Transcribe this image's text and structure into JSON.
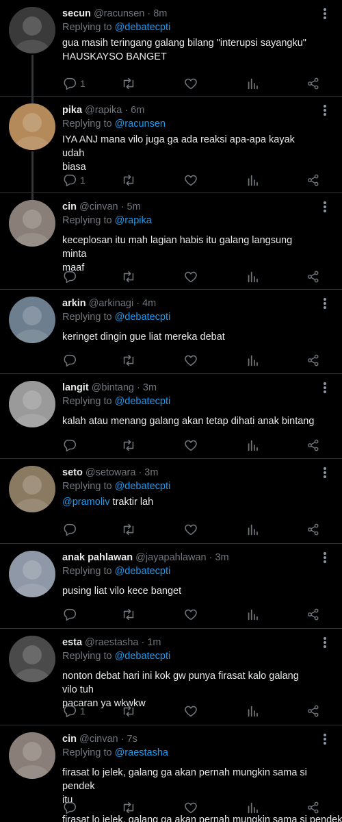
{
  "tweets": [
    {
      "name": "secun",
      "handle": "@racunsen",
      "time": "· 8m",
      "reply_prefix": "Replying to",
      "reply_to": "@debatecpti",
      "text_lines": [
        "gua masih teringang galang bilang \"interupsi sayangku\"",
        "HAUSKAYSO BANGET"
      ],
      "mention_lead": "",
      "reply_count": "1",
      "avatar_color": "#3a3a3a"
    },
    {
      "name": "pika",
      "handle": "@rapika",
      "time": "· 6m",
      "reply_prefix": "Replying to",
      "reply_to": "@racunsen",
      "text_lines": [
        "IYA ANJ mana vilo juga ga ada reaksi apa-apa kayak udah",
        "biasa"
      ],
      "mention_lead": "",
      "reply_count": "1",
      "avatar_color": "#b48a5a"
    },
    {
      "name": "cin",
      "handle": "@cinvan",
      "time": "· 5m",
      "reply_prefix": "Replying to",
      "reply_to": "@rapika",
      "text_lines": [
        "keceplosan itu mah lagian habis itu galang langsung minta",
        "maaf"
      ],
      "mention_lead": "",
      "reply_count": "",
      "avatar_color": "#8a7f78"
    },
    {
      "name": "arkin",
      "handle": "@arkinagi",
      "time": "· 4m",
      "reply_prefix": "Replying to",
      "reply_to": "@debatecpti",
      "text_lines": [
        "keringet dingin gue liat mereka debat"
      ],
      "mention_lead": "",
      "reply_count": "",
      "avatar_color": "#6d7f8e"
    },
    {
      "name": "langit",
      "handle": "@bintang",
      "time": "· 3m",
      "reply_prefix": "Replying to",
      "reply_to": "@debatecpti",
      "text_lines": [
        "kalah atau menang galang akan tetap dihati anak bintang"
      ],
      "mention_lead": "",
      "reply_count": "",
      "avatar_color": "#9a9a9a"
    },
    {
      "name": "seto",
      "handle": "@setowara",
      "time": "· 3m",
      "reply_prefix": "Replying to",
      "reply_to": "@debatecpti",
      "text_lines": [
        "traktir lah"
      ],
      "mention_lead": "@pramoliv",
      "reply_count": "",
      "avatar_color": "#8b7a62"
    },
    {
      "name": "anak pahlawan",
      "handle": "@jayapahlawan",
      "time": "· 3m",
      "reply_prefix": "Replying to",
      "reply_to": "@debatecpti",
      "text_lines": [
        "pusing liat vilo kece banget"
      ],
      "mention_lead": "",
      "reply_count": "",
      "avatar_color": "#8e98a6"
    },
    {
      "name": "esta",
      "handle": "@raestasha",
      "time": "· 1m",
      "reply_prefix": "Replying to",
      "reply_to": "@debatecpti",
      "text_lines": [
        "nonton debat hari ini kok gw punya firasat kalo galang vilo tuh",
        "pacaran ya wkwkw"
      ],
      "mention_lead": "",
      "reply_count": "1",
      "avatar_color": "#4a4a4a"
    },
    {
      "name": "cin",
      "handle": "@cinvan",
      "time": "· 7s",
      "reply_prefix": "Replying to",
      "reply_to": "@raestasha",
      "text_lines": [
        "firasat lo jelek, galang ga akan pernah mungkin sama si pendek",
        "itu"
      ],
      "mention_lead": "",
      "reply_count": "",
      "avatar_color": "#8a7f78"
    }
  ],
  "partial_text": "firasat lo jelek, galang ga akan pernah mungkin sama si pendek",
  "icons": {
    "reply": "reply-icon",
    "retweet": "retweet-icon",
    "like": "heart-icon",
    "views": "views-icon",
    "share": "share-icon",
    "more": "more-icon"
  },
  "colors": {
    "background": "#000000",
    "text": "#e7e9ea",
    "muted": "#71767b",
    "link": "#1d9bf0",
    "divider": "#2f3336"
  }
}
